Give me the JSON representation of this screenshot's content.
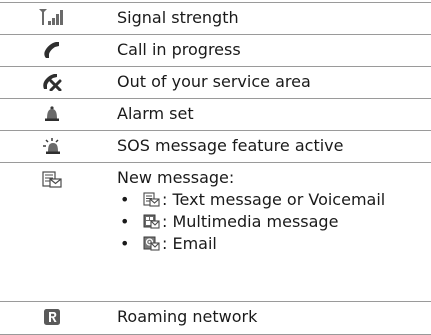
{
  "rows": [
    {
      "icon": "signal-strength-icon",
      "label": "Signal strength"
    },
    {
      "icon": "call-in-progress-icon",
      "label": "Call in progress"
    },
    {
      "icon": "out-of-service-icon",
      "label": "Out of your service area"
    },
    {
      "icon": "alarm-bell-icon",
      "label": "Alarm set"
    },
    {
      "icon": "sos-icon",
      "label": "SOS message feature active"
    },
    {
      "icon": "new-message-envelope-icon",
      "label": "New message:",
      "items": [
        {
          "icon": "text-message-envelope-icon",
          "text": ": Text message or Voicemail"
        },
        {
          "icon": "multimedia-message-icon",
          "text": ": Multimedia message"
        },
        {
          "icon": "email-icon",
          "text": ": Email"
        }
      ],
      "bullet": "•"
    },
    {
      "icon": "roaming-icon",
      "label": "Roaming network"
    }
  ]
}
